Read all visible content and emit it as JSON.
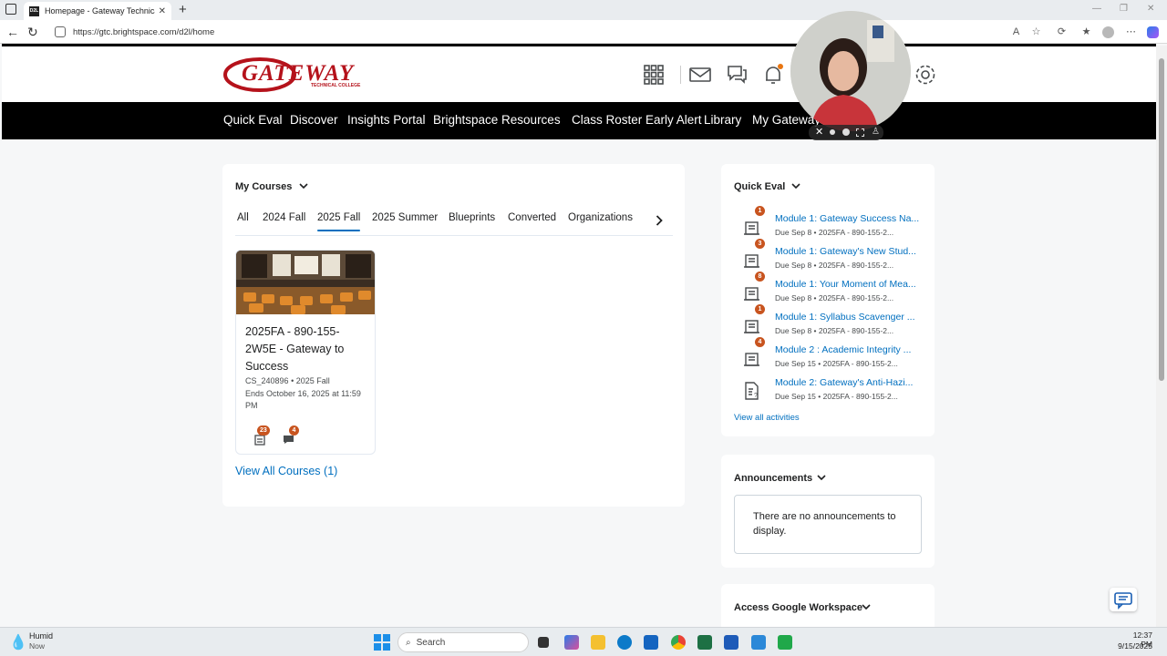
{
  "browser": {
    "tab_title": "Homepage - Gateway Technical C",
    "tab_favicon": "D2L",
    "url": "https://gtc.brightspace.com/d2l/home"
  },
  "header": {
    "logo_word": "GATEWAY",
    "logo_sub": "TECHNICAL COLLEGE",
    "nav": [
      "Quick Eval",
      "Discover",
      "Insights Portal",
      "Brightspace Resources",
      "Class Roster Early Alert",
      "Library",
      "My Gateway"
    ]
  },
  "my_courses": {
    "title": "My Courses",
    "tabs": [
      "All",
      "2024 Fall",
      "2025 Fall",
      "2025 Summer",
      "Blueprints",
      "Converted",
      "Organizations"
    ],
    "active_tab": "2025 Fall",
    "course": {
      "name": "2025FA - 890-155-2W5E - Gateway to Success",
      "code": "CS_240896",
      "term": "2025 Fall",
      "ends": "Ends October 16, 2025 at 11:59 PM",
      "assignments_badge": "23",
      "discussions_badge": "4"
    },
    "view_all": "View All Courses (1)"
  },
  "quick_eval": {
    "title": "Quick Eval",
    "items": [
      {
        "title": "Module 1: Gateway Success Na...",
        "due": "Due Sep 8",
        "course": "2025FA - 890-155-2...",
        "badge": "1"
      },
      {
        "title": "Module 1: Gateway's New Stud...",
        "due": "Due Sep 8",
        "course": "2025FA - 890-155-2...",
        "badge": "3"
      },
      {
        "title": "Module 1: Your Moment of Mea...",
        "due": "Due Sep 8",
        "course": "2025FA - 890-155-2...",
        "badge": "8"
      },
      {
        "title": "Module 1: Syllabus Scavenger ...",
        "due": "Due Sep 8",
        "course": "2025FA - 890-155-2...",
        "badge": "1"
      },
      {
        "title": "Module 2 : Academic Integrity ...",
        "due": "Due Sep 15",
        "course": "2025FA - 890-155-2...",
        "badge": "4"
      },
      {
        "title": "Module 2: Gateway's Anti-Hazi...",
        "due": "Due Sep 15",
        "course": "2025FA - 890-155-2...",
        "badge": ""
      }
    ],
    "view_all": "View all activities"
  },
  "announcements": {
    "title": "Announcements",
    "empty_text": "There are no announcements to display."
  },
  "google": {
    "title": "Access Google Workspace"
  },
  "taskbar": {
    "weather_label": "Humid",
    "weather_sub": "Now",
    "search": "Search",
    "time": "12:37 PM",
    "date": "9/15/2025"
  },
  "colors": {
    "accent": "#006fbf",
    "badge": "#c8541f",
    "brand": "#b5121b"
  }
}
